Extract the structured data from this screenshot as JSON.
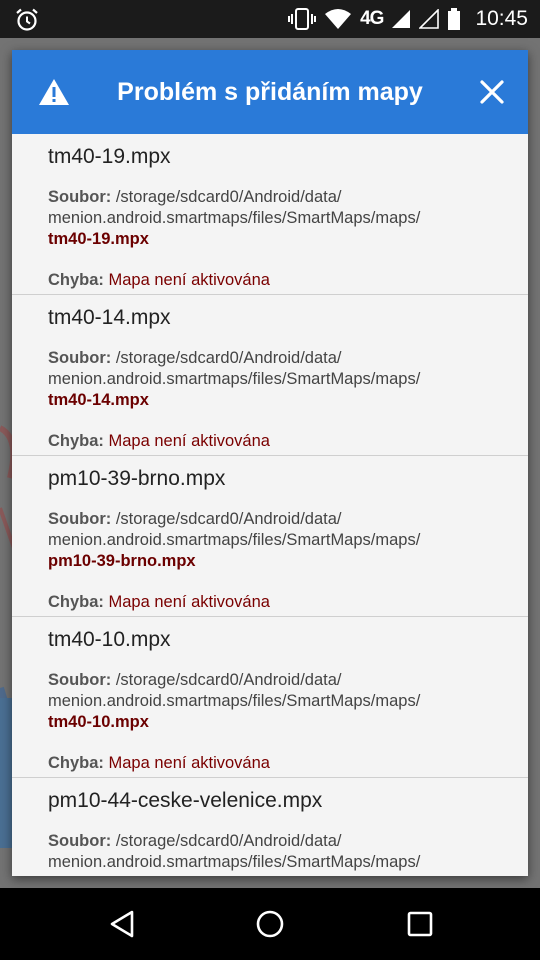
{
  "status_bar": {
    "time": "10:45",
    "network": "4G",
    "icons": [
      "alarm-icon",
      "vibrate-icon",
      "wifi-icon",
      "signal-icon",
      "battery-icon"
    ]
  },
  "dialog": {
    "title": "Problém s přidáním mapy",
    "header_color": "#2a7ad8",
    "icons": [
      "warning-icon",
      "close-icon"
    ],
    "items": [
      {
        "name": "tm40-19.mpx",
        "path_label": "Soubor:",
        "path_line1": "/storage/sdcard0/Android/data/",
        "path_line2": "menion.android.smartmaps/files/SmartMaps/maps/",
        "path_file": "tm40-19.mpx",
        "error_label": "Chyba:",
        "error_text": "Mapa není aktivována"
      },
      {
        "name": "tm40-14.mpx",
        "path_label": "Soubor:",
        "path_line1": "/storage/sdcard0/Android/data/",
        "path_line2": "menion.android.smartmaps/files/SmartMaps/maps/",
        "path_file": "tm40-14.mpx",
        "error_label": "Chyba:",
        "error_text": "Mapa není aktivována"
      },
      {
        "name": "pm10-39-brno.mpx",
        "path_label": "Soubor:",
        "path_line1": "/storage/sdcard0/Android/data/",
        "path_line2": "menion.android.smartmaps/files/SmartMaps/maps/",
        "path_file": "pm10-39-brno.mpx",
        "error_label": "Chyba:",
        "error_text": "Mapa není aktivována"
      },
      {
        "name": "tm40-10.mpx",
        "path_label": "Soubor:",
        "path_line1": "/storage/sdcard0/Android/data/",
        "path_line2": "menion.android.smartmaps/files/SmartMaps/maps/",
        "path_file": "tm40-10.mpx",
        "error_label": "Chyba:",
        "error_text": "Mapa není aktivována"
      },
      {
        "name": "pm10-44-ceske-velenice.mpx",
        "path_label": "Soubor:",
        "path_line1": "/storage/sdcard0/Android/data/",
        "path_line2": "menion.android.smartmaps/files/SmartMaps/maps/",
        "path_file": "",
        "error_label": "",
        "error_text": ""
      }
    ]
  },
  "nav_bar": {
    "icons": [
      "back-icon",
      "home-icon",
      "recents-icon"
    ]
  }
}
